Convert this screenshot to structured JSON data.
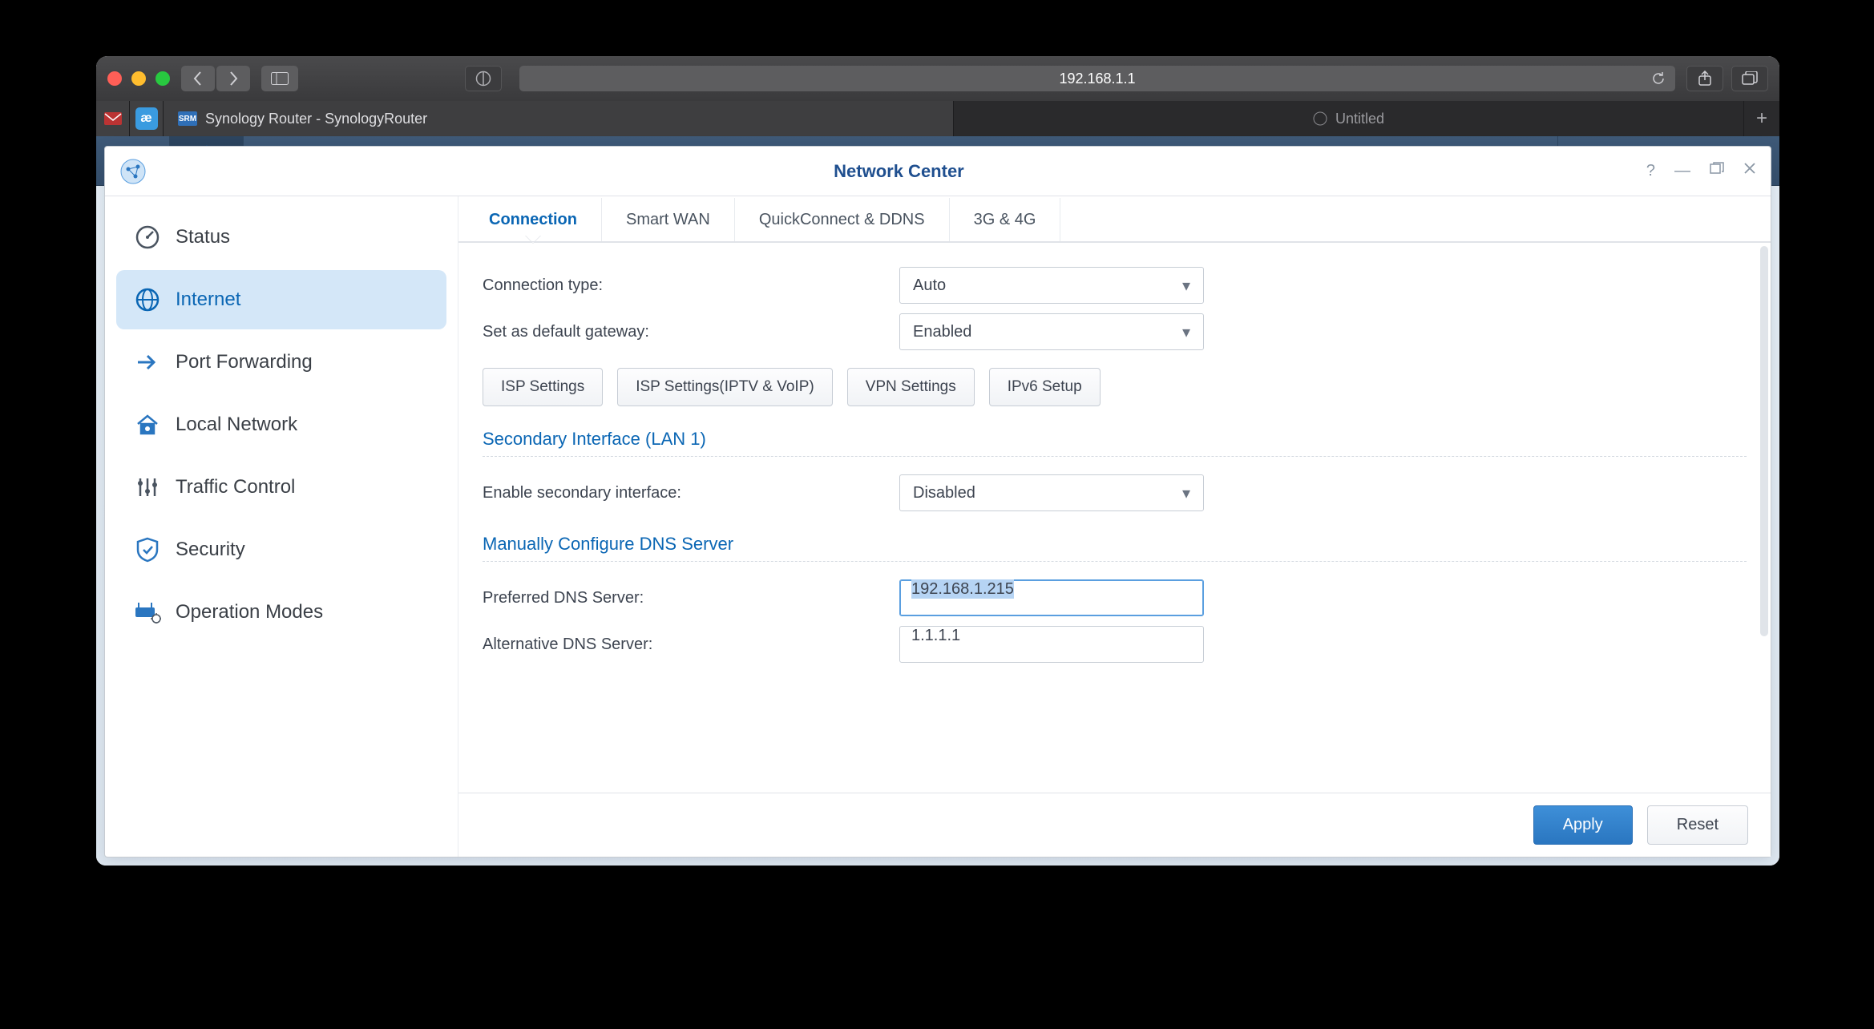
{
  "browser": {
    "address": "192.168.1.1",
    "tabs": [
      {
        "label": "Synology Router - SynologyRouter"
      },
      {
        "label": "Untitled"
      }
    ]
  },
  "window": {
    "title": "Network Center"
  },
  "sidebar": {
    "items": [
      {
        "label": "Status"
      },
      {
        "label": "Internet"
      },
      {
        "label": "Port Forwarding"
      },
      {
        "label": "Local Network"
      },
      {
        "label": "Traffic Control"
      },
      {
        "label": "Security"
      },
      {
        "label": "Operation Modes"
      }
    ]
  },
  "main": {
    "tabs": [
      {
        "label": "Connection"
      },
      {
        "label": "Smart WAN"
      },
      {
        "label": "QuickConnect & DDNS"
      },
      {
        "label": "3G & 4G"
      }
    ],
    "fields": {
      "connection_type_label": "Connection type:",
      "connection_type_value": "Auto",
      "default_gateway_label": "Set as default gateway:",
      "default_gateway_value": "Enabled",
      "secondary_heading": "Secondary Interface (LAN 1)",
      "secondary_enable_label": "Enable secondary interface:",
      "secondary_enable_value": "Disabled",
      "dns_heading": "Manually Configure DNS Server",
      "preferred_dns_label": "Preferred DNS Server:",
      "preferred_dns_value": "192.168.1.215",
      "alt_dns_label": "Alternative DNS Server:",
      "alt_dns_value": "1.1.1.1"
    },
    "buttons": {
      "isp": "ISP Settings",
      "isp_iptv": "ISP Settings(IPTV & VoIP)",
      "vpn": "VPN Settings",
      "ipv6": "IPv6 Setup"
    }
  },
  "footer": {
    "apply": "Apply",
    "reset": "Reset"
  }
}
